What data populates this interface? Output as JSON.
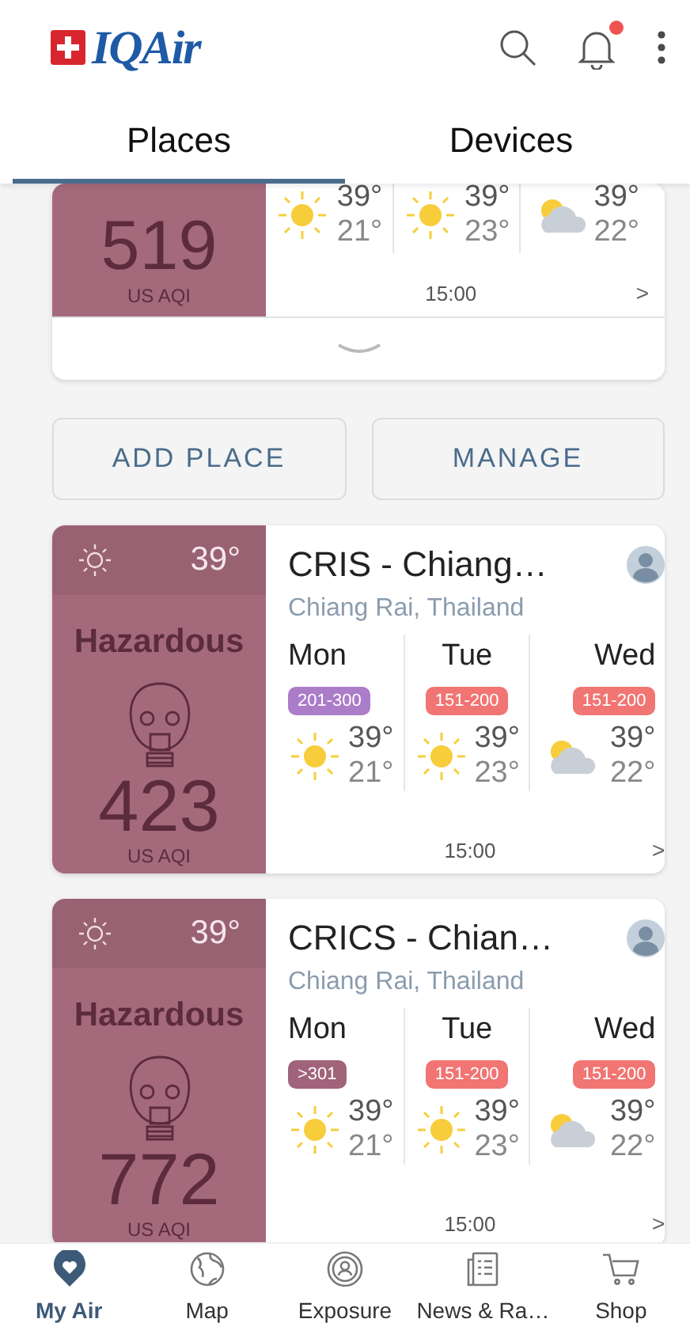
{
  "header": {
    "logo": "IQAir",
    "notification_dot": true
  },
  "tabs": [
    {
      "label": "Places",
      "selected": true
    },
    {
      "label": "Devices",
      "selected": false
    }
  ],
  "partial_place": {
    "aqi": "519",
    "aqi_unit": "US AQI",
    "color": "#a46a7b",
    "forecast": [
      {
        "kind": "sun",
        "high": "39°",
        "low": "21°"
      },
      {
        "kind": "sun",
        "high": "39°",
        "low": "23°"
      },
      {
        "kind": "cloud",
        "high": "39°",
        "low": "22°"
      }
    ],
    "time": "15:00",
    "more": ">"
  },
  "actions": [
    "ADD PLACE",
    "MANAGE"
  ],
  "places": [
    {
      "current_temp": "39°",
      "status": "Hazardous",
      "aqi": "423",
      "aqi_unit": "US AQI",
      "color": "#a46a7b",
      "name": "CRIS - Chiang…",
      "location": "Chiang Rai, Thailand",
      "forecast": [
        {
          "day": "Mon",
          "range": "201-300",
          "color": "#ab7cc8",
          "kind": "sun",
          "high": "39°",
          "low": "21°"
        },
        {
          "day": "Tue",
          "range": "151-200",
          "color": "#f07573",
          "kind": "sun",
          "high": "39°",
          "low": "23°"
        },
        {
          "day": "Wed",
          "range": "151-200",
          "color": "#f07573",
          "kind": "cloud",
          "high": "39°",
          "low": "22°"
        }
      ],
      "time": "15:00",
      "more": ">"
    },
    {
      "current_temp": "39°",
      "status": "Hazardous",
      "aqi": "772",
      "aqi_unit": "US AQI",
      "color": "#a46a7b",
      "name": "CRICS - Chian…",
      "location": "Chiang Rai, Thailand",
      "forecast": [
        {
          "day": "Mon",
          "range": ">301",
          "color": "#a0637a",
          "kind": "sun",
          "high": "39°",
          "low": "21°"
        },
        {
          "day": "Tue",
          "range": "151-200",
          "color": "#f07573",
          "kind": "sun",
          "high": "39°",
          "low": "23°"
        },
        {
          "day": "Wed",
          "range": "151-200",
          "color": "#f07573",
          "kind": "cloud",
          "high": "39°",
          "low": "22°"
        }
      ],
      "time": "15:00",
      "more": ">"
    }
  ],
  "bottom_nav": [
    {
      "label": "My Air",
      "selected": true
    },
    {
      "label": "Map",
      "selected": false
    },
    {
      "label": "Exposure",
      "selected": false
    },
    {
      "label": "News & Ra…",
      "selected": false
    },
    {
      "label": "Shop",
      "selected": false
    }
  ]
}
